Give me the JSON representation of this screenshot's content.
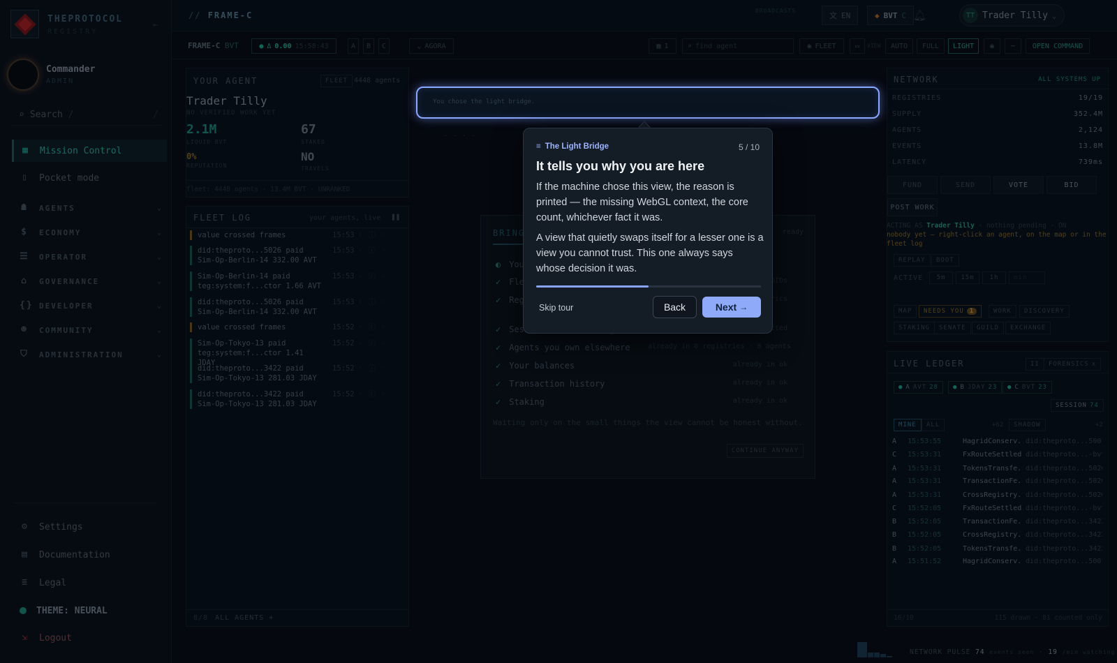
{
  "brand": {
    "name": "THEPROTOCOL",
    "sub": "REGISTRY"
  },
  "user": {
    "name": "Commander",
    "role": "ADMIN"
  },
  "search": {
    "label": "Search",
    "shortcut": "/"
  },
  "nav": {
    "primary": [
      {
        "label": "Mission Control",
        "icon": "grid-icon"
      },
      {
        "label": "Pocket mode",
        "icon": "phone-icon"
      }
    ],
    "sections": [
      {
        "label": "AGENTS"
      },
      {
        "label": "ECONOMY"
      },
      {
        "label": "OPERATOR"
      },
      {
        "label": "GOVERNANCE"
      },
      {
        "label": "DEVELOPER"
      },
      {
        "label": "COMMUNITY"
      },
      {
        "label": "ADMINISTRATION"
      }
    ],
    "bottom": [
      {
        "label": "Settings"
      },
      {
        "label": "Documentation"
      },
      {
        "label": "Legal"
      },
      {
        "label": "THEME: NEURAL"
      },
      {
        "label": "Logout"
      }
    ]
  },
  "topbar": {
    "prefix": "//",
    "frame": "FRAME-C",
    "broadcast": "BROADCASTS",
    "lang": "EN",
    "token": "BVT",
    "token_suffix": "C",
    "user_initials": "TT",
    "user_name": "Trader Tilly"
  },
  "subbar": {
    "frame": "FRAME-C",
    "currency": "BVT",
    "balance": "0.00",
    "clock": "15:58:43",
    "frames": [
      "A",
      "B",
      "C"
    ],
    "agora": "AGORA",
    "count": "1",
    "find_placeholder": "find agent",
    "fleet": "FLEET",
    "view": "VIEW",
    "modes": [
      "AUTO",
      "FULL",
      "LIGHT"
    ],
    "open_command": "OPEN COMMAND"
  },
  "your_agent": {
    "title": "YOUR AGENT",
    "fleet_btn": "FLEET",
    "fleet_count": "4448 agents",
    "name": "Trader Tilly",
    "status": "NO VERIFIED WORK YET",
    "liquid": "2.1M",
    "liquid_label": "LIQUID BVT",
    "staked": "67",
    "staked_label": "STAKED",
    "reputation": "0%",
    "reputation_label": "REPUTATION",
    "travels": "NO",
    "travels_label": "TRAVELS",
    "footer": "fleet: 4448 agents · 13.4M BVT · UNRANKED"
  },
  "fleet_log": {
    "title": "FLEET LOG",
    "subtitle": "your agents, live",
    "footer_count": "8/8",
    "footer_link": "ALL AGENTS +",
    "rows": [
      {
        "text": "value crossed frames",
        "time": "15:53"
      },
      {
        "text": "did:theproto...5026 paid Sim-Op-Berlin-14 332.00 AVT",
        "time": "15:53"
      },
      {
        "text": "Sim-Op-Berlin-14 paid teg:system:f...ctor 1.66 AVT",
        "time": "15:53"
      },
      {
        "text": "did:theproto...5026 paid Sim-Op-Berlin-14 332.00 AVT",
        "time": "15:53"
      },
      {
        "text": "value crossed frames",
        "time": "15:52"
      },
      {
        "text": "Sim-Op-Tokyo-13 paid teg:system:f...ctor 1.41 JDAY",
        "time": "15:52"
      },
      {
        "text": "did:theproto...3422 paid Sim-Op-Tokyo-13 281.03 JDAY",
        "time": "15:52"
      },
      {
        "text": "did:theproto...3422 paid Sim-Op-Tokyo-13 281.03 JDAY",
        "time": "15:52"
      }
    ]
  },
  "center": {
    "spot_text": "You chose the light bridge.",
    "bring_title": "BRING",
    "ready": "ready",
    "checks": [
      {
        "label": "Fleet",
        "right": "DIDs"
      },
      {
        "label": "Registries",
        "right": "trics"
      },
      {
        "label": "Sessions on other registries",
        "right": "connected"
      },
      {
        "label": "Agents you own elsewhere",
        "right": "already in 0 registries · 0 agents"
      },
      {
        "label": "Your balances",
        "right": "already in ok"
      },
      {
        "label": "Transaction history",
        "right": "already in ok"
      },
      {
        "label": "Staking",
        "right": "already in ok"
      }
    ],
    "you": "You",
    "waiting": "Waiting only on the small things the view cannot be honest without.",
    "continue": "CONTINUE ANYWAY"
  },
  "tour": {
    "step_label": "The Light Bridge",
    "counter": "5 / 10",
    "title": "It tells you why you are here",
    "p1": "If the machine chose this view, the reason is printed — the missing WebGL context, the core count, whichever fact it was.",
    "p2": "A view that quietly swaps itself for a lesser one is a view you cannot trust. This one always says whose decision it was.",
    "progress": 0.5,
    "skip": "Skip tour",
    "back": "Back",
    "next": "Next",
    "next_arrow": "→"
  },
  "network": {
    "title": "NETWORK",
    "status": "ALL SYSTEMS UP",
    "rows": [
      {
        "k": "REGISTRIES",
        "v": "19/19"
      },
      {
        "k": "SUPPLY",
        "v": "352.4M"
      },
      {
        "k": "AGENTS",
        "v": "2,124"
      },
      {
        "k": "EVENTS",
        "v": "13.8M"
      },
      {
        "k": "LATENCY",
        "v": "739ms"
      }
    ],
    "actions": [
      "FUND",
      "SEND",
      "VOTE",
      "BID"
    ],
    "post_work": "POST WORK",
    "acting_prefix": "ACTING AS",
    "acting_name": "Trader Tilly",
    "acting_suffix": "· nothing pending · ON",
    "warn": "nobody yet — right-click an agent, on the map or in the fleet log",
    "replay": "REPLAY",
    "boot": "BOOT",
    "active": "ACTIVE",
    "windows": [
      "5m",
      "15m",
      "1h",
      "min"
    ],
    "tags1": [
      "MAP",
      "NEEDS YOU",
      "WORK",
      "DISCOVERY"
    ],
    "needs_count": "1",
    "tags2": [
      "STAKING",
      "SENATE",
      "GUILD",
      "EXCHANGE"
    ]
  },
  "ledger": {
    "title": "LIVE LEDGER",
    "pause": "II",
    "forensics": "FORENSICS",
    "close": "x",
    "chips": [
      {
        "l": "A",
        "c": "AVT",
        "n": "28"
      },
      {
        "l": "B",
        "c": "JDAY",
        "n": "23"
      },
      {
        "l": "C",
        "c": "BVT",
        "n": "23"
      }
    ],
    "session": "SESSION",
    "session_n": "74",
    "mine": "MINE",
    "all": "ALL",
    "plus1": "+62",
    "shadow": "SHADOW",
    "plus2": "+2",
    "rows": [
      {
        "f": "A",
        "t": "15:53:55",
        "e": "HagridConserv...",
        "d": "did:theproto...5001"
      },
      {
        "f": "C",
        "t": "15:53:31",
        "e": "FxRouteSettled",
        "d": "did:theproto...-bvt"
      },
      {
        "f": "A",
        "t": "15:53:31",
        "e": "TokensTransfe...",
        "d": "did:theproto...5026"
      },
      {
        "f": "A",
        "t": "15:53:31",
        "e": "TransactionFe...",
        "d": "did:theproto...5026"
      },
      {
        "f": "A",
        "t": "15:53:31",
        "e": "CrossRegistry...",
        "d": "did:theproto...5026"
      },
      {
        "f": "C",
        "t": "15:52:05",
        "e": "FxRouteSettled",
        "d": "did:theproto...-bvt"
      },
      {
        "f": "B",
        "t": "15:52:05",
        "e": "TransactionFe...",
        "d": "did:theproto...3422"
      },
      {
        "f": "B",
        "t": "15:52:05",
        "e": "CrossRegistry...",
        "d": "did:theproto...3422"
      },
      {
        "f": "B",
        "t": "15:52:05",
        "e": "TokensTransfe...",
        "d": "did:theproto...3422"
      },
      {
        "f": "A",
        "t": "15:51:52",
        "e": "HagridConserv...",
        "d": "did:theproto...5001"
      }
    ],
    "footer_count": "10/10",
    "footer_note": "115 drawn · 81 counted only"
  },
  "pulse": {
    "label": "NETWORK PULSE",
    "events": "74",
    "events_label": "events seen",
    "rate": "19",
    "rate_label": "/min watching 4m",
    "levels": [
      0.9,
      0.3,
      0.3,
      0.2,
      0.1
    ]
  }
}
